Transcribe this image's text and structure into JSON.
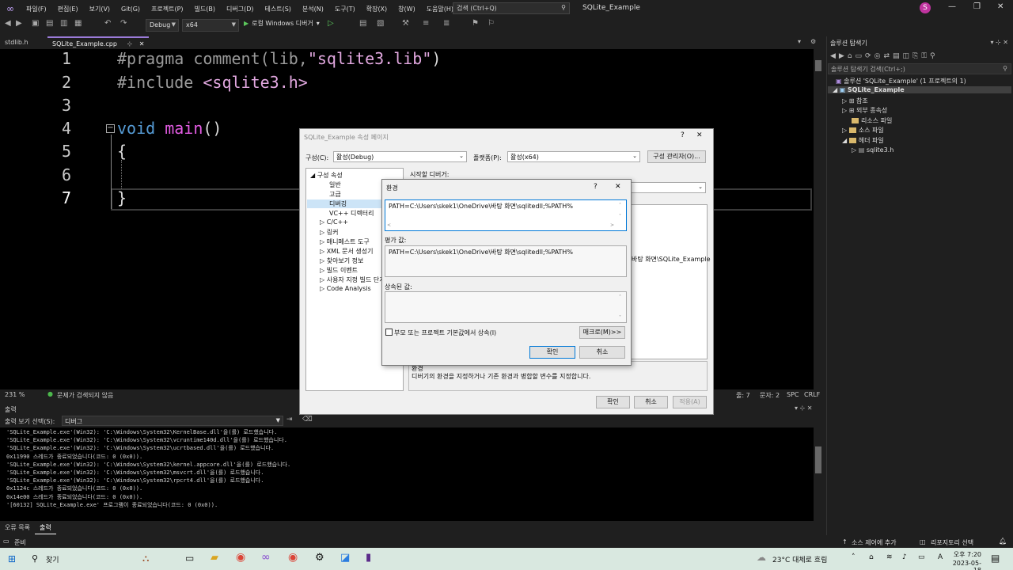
{
  "menu": [
    "파일(F)",
    "편집(E)",
    "보기(V)",
    "Git(G)",
    "프로젝트(P)",
    "빌드(B)",
    "디버그(D)",
    "테스트(S)",
    "분석(N)",
    "도구(T)",
    "확장(X)",
    "창(W)",
    "도움말(H)"
  ],
  "search_placeholder": "검색 (Ctrl+Q)",
  "app_title": "SQLite_Example",
  "avatar_letter": "S",
  "toolbar": {
    "config": "Debug",
    "platform": "x64",
    "run_label": "로컬 Windows 디버거"
  },
  "tabs": [
    {
      "label": "stdlib.h"
    },
    {
      "label": "SQLite_Example.cpp"
    }
  ],
  "editor": {
    "line_numbers": [
      "1",
      "2",
      "3",
      "4",
      "5",
      "6",
      "7"
    ],
    "lines": {
      "l1a": "#pragma comment(lib,",
      "l1b": "\"sqlite3.lib\"",
      "l1c": ")",
      "l2a": "#include ",
      "l2b": "<sqlite3.h>",
      "l4a": "void",
      "l4b": " ",
      "l4c": "main",
      "l4d": "()",
      "l5": "{",
      "l7": "}"
    },
    "zoom": "231 %",
    "problems": "문제가 검색되지 않음",
    "line": "줄: 7",
    "col": "문자: 2",
    "space": "SPC",
    "eol": "CRLF"
  },
  "output": {
    "title": "출력",
    "source_label": "출력 보기 선택(S):",
    "source_value": "디버그",
    "text": "'SQLite_Example.exe'(Win32): 'C:\\Windows\\System32\\KernelBase.dll'을(를) 로드했습니다.\n'SQLite_Example.exe'(Win32): 'C:\\Windows\\System32\\vcruntime140d.dll'을(를) 로드했습니다.\n'SQLite_Example.exe'(Win32): 'C:\\Windows\\System32\\ucrtbased.dll'을(를) 로드했습니다.\n0x11990 스레드가 종료되었습니다(코드: 0 (0x0)).\n'SQLite_Example.exe'(Win32): 'C:\\Windows\\System32\\kernel.appcore.dll'을(를) 로드했습니다.\n'SQLite_Example.exe'(Win32): 'C:\\Windows\\System32\\msvcrt.dll'을(를) 로드했습니다.\n'SQLite_Example.exe'(Win32): 'C:\\Windows\\System32\\rpcrt4.dll'을(를) 로드했습니다.\n0x1124c 스레드가 종료되었습니다(코드: 0 (0x0)).\n0x14e00 스레드가 종료되었습니다(코드: 0 (0x0)).\n'[60132] SQLite_Example.exe' 프로그램이 종료되었습니다(코드: 0 (0x0)).",
    "tabs": [
      "오류 목록",
      "출력"
    ]
  },
  "statusbar": {
    "ready": "준비",
    "source_control": "소스 제어에 추가",
    "repo": "리포지토리 선택"
  },
  "solution": {
    "title": "솔루션 탐색기",
    "search": "솔루션 탐색기 검색(Ctrl+;)",
    "items": [
      "솔루션 'SQLite_Example' (1 프로젝트의 1)",
      "SQLite_Example",
      "참조",
      "외부 종속성",
      "리소스 파일",
      "소스 파일",
      "헤더 파일",
      "sqlite3.h"
    ]
  },
  "prop": {
    "title": "SQLite_Example 속성 페이지",
    "config_label": "구성(C):",
    "config_value": "활성(Debug)",
    "platform_label": "플랫폼(P):",
    "platform_value": "활성(x64)",
    "config_mgr": "구성 관리자(O)...",
    "nav": [
      "구성 속성",
      "일반",
      "고급",
      "디버깅",
      "VC++ 디렉터리",
      "C/C++",
      "링커",
      "매니페스트 도구",
      "XML 문서 생성기",
      "찾아보기 정보",
      "빌드 이벤트",
      "사용자 지정 빌드 단계",
      "Code Analysis"
    ],
    "debugger_label": "시작할 디버거:",
    "partial_value": "바탕 화면\\SQLite_Example",
    "desc_title": "환경",
    "desc_text": "디버기의 환경을 지정하거나 기존 환경과 병합할 변수를 지정합니다.",
    "ok": "확인",
    "cancel": "취소",
    "apply": "적용(A)"
  },
  "env": {
    "title": "환경",
    "help": "?",
    "close": "✕",
    "value": "PATH=C:\\Users\\skek1\\OneDrive\\바탕 화면\\sqlitedll;%PATH%",
    "eval_label": "평가 값:",
    "eval_value": "PATH=C:\\Users\\skek1\\OneDrive\\바탕 화면\\sqlitedll;%PATH%",
    "inherited_label": "상속된 값:",
    "inherit_check": "부모 또는 프로젝트 기본값에서 상속(I)",
    "macro_btn": "매크로(M)>>",
    "ok": "확인",
    "cancel": "취소"
  },
  "taskbar": {
    "search": "찾기",
    "weather": "23°C  대체로 흐림",
    "time": "오후 7:20",
    "date": "2023-05-18"
  }
}
